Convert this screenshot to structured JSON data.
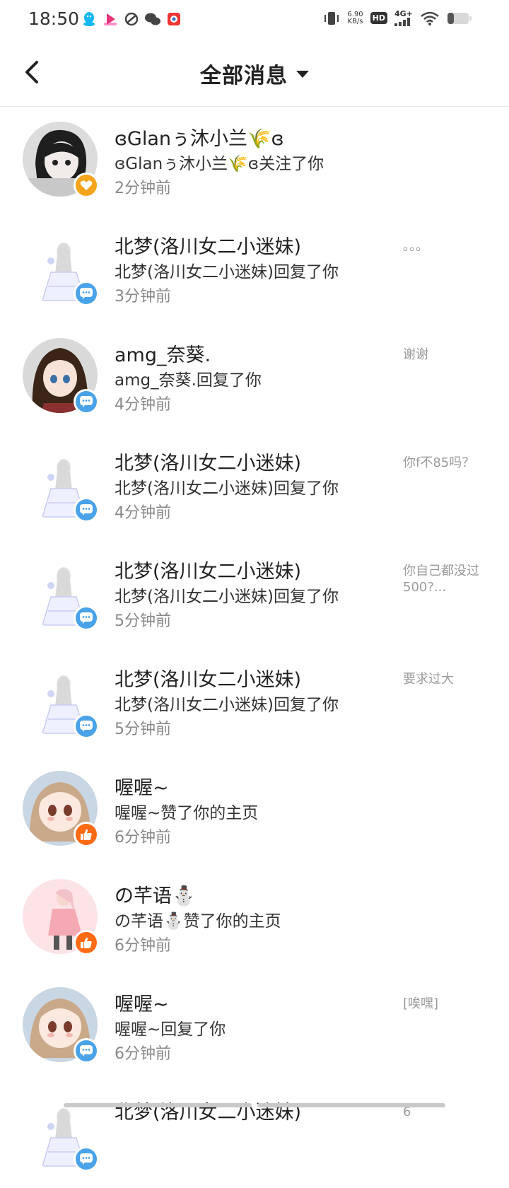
{
  "status_bar": {
    "time": "18:50",
    "net_speed": "6.90",
    "net_speed_unit": "KB/s",
    "hd": "HD",
    "network": "4G+",
    "app_icons": [
      "qq-icon",
      "video-app-icon",
      "link-app-icon",
      "wechat-icon",
      "baidu-icon"
    ]
  },
  "header": {
    "title": "全部消息",
    "back_icon": "chevron-left-icon",
    "dropdown_icon": "caret-down-icon"
  },
  "notifications": [
    {
      "name": "ɞGlanぅ沐小兰🌾ɞ",
      "action": "ɞGlanぅ沐小兰🌾ɞ关注了你",
      "time": "2分钟前",
      "preview": "",
      "badge": "gold",
      "badge_icon": "heart-icon",
      "avatar": "bw"
    },
    {
      "name": "北梦(洛川女二小迷妹)",
      "action": "北梦(洛川女二小迷妹)回复了你",
      "time": "3分钟前",
      "preview": "。。。",
      "badge": "blue",
      "badge_icon": "comment-icon",
      "avatar": "maid"
    },
    {
      "name": "amg_奈葵.",
      "action": "amg_奈葵.回复了你",
      "time": "4分钟前",
      "preview": "谢谢",
      "badge": "blue",
      "badge_icon": "comment-icon",
      "avatar": "girl"
    },
    {
      "name": "北梦(洛川女二小迷妹)",
      "action": "北梦(洛川女二小迷妹)回复了你",
      "time": "4分钟前",
      "preview": "你f不85吗？",
      "badge": "blue",
      "badge_icon": "comment-icon",
      "avatar": "maid"
    },
    {
      "name": "北梦(洛川女二小迷妹)",
      "action": "北梦(洛川女二小迷妹)回复了你",
      "time": "5分钟前",
      "preview": "你自己都没过500?...",
      "badge": "blue",
      "badge_icon": "comment-icon",
      "avatar": "maid"
    },
    {
      "name": "北梦(洛川女二小迷妹)",
      "action": "北梦(洛川女二小迷妹)回复了你",
      "time": "5分钟前",
      "preview": "要求过大",
      "badge": "blue",
      "badge_icon": "comment-icon",
      "avatar": "maid"
    },
    {
      "name": "喔喔~",
      "action": "喔喔~赞了你的主页",
      "time": "6分钟前",
      "preview": "",
      "badge": "orange",
      "badge_icon": "thumbs-up-icon",
      "avatar": "chibi"
    },
    {
      "name": "の芊语⛄",
      "action": "の芊语⛄赞了你的主页",
      "time": "6分钟前",
      "preview": "",
      "badge": "orange",
      "badge_icon": "thumbs-up-icon",
      "avatar": "pink"
    },
    {
      "name": "喔喔~",
      "action": "喔喔~回复了你",
      "time": "6分钟前",
      "preview": "[唉嘿]",
      "badge": "blue",
      "badge_icon": "comment-icon",
      "avatar": "chibi"
    },
    {
      "name": "北梦(洛川女二小迷妹)",
      "action": "",
      "time": "",
      "preview": "6",
      "badge": "blue",
      "badge_icon": "comment-icon",
      "avatar": "maid"
    }
  ]
}
